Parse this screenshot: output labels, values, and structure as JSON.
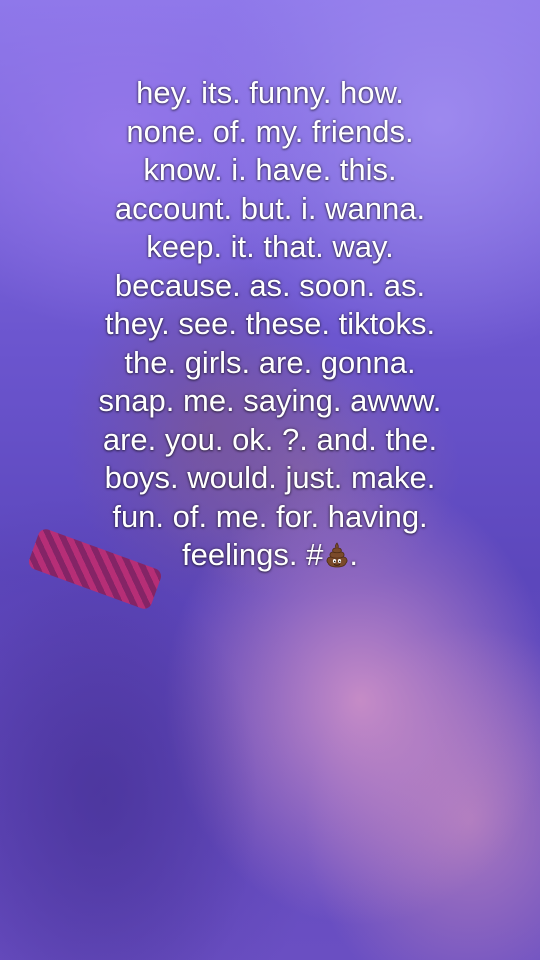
{
  "caption": {
    "lines": [
      "hey. its. funny. how.",
      "none. of. my. friends.",
      "know. i. have. this.",
      "account. but. i. wanna.",
      "keep. it. that. way.",
      "because. as. soon. as.",
      "they. see. these. tiktoks.",
      "the. girls. are. gonna.",
      "snap. me. saying. awww.",
      "are. you. ok. ?. and. the.",
      "boys. would. just. make.",
      "fun. of. me. for. having."
    ],
    "last_line_prefix": "feelings. #",
    "last_line_suffix": ".",
    "emoji_icon": "pile-of-poo-icon"
  },
  "colors": {
    "text": "#ffffff",
    "background_tint": "#6b55c4"
  }
}
